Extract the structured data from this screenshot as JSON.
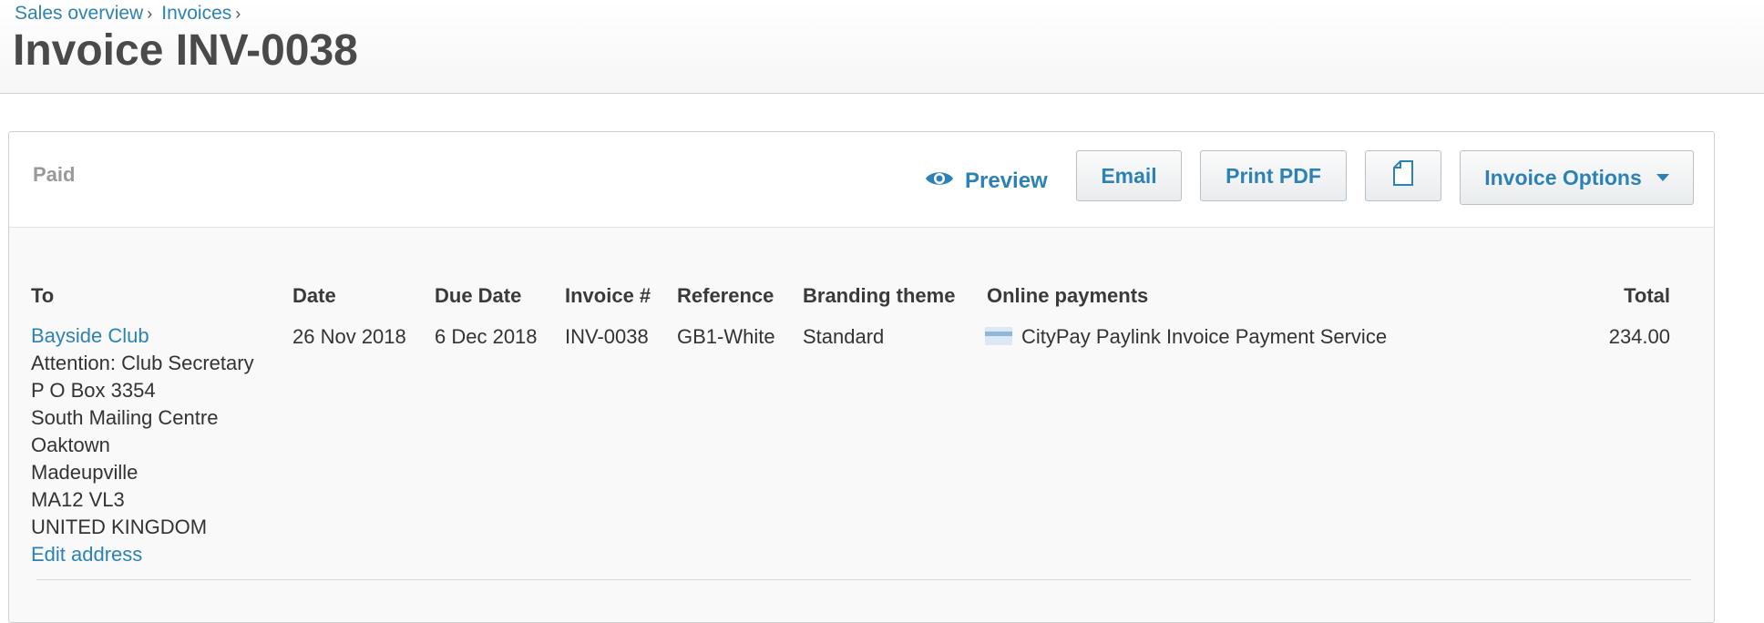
{
  "breadcrumb": [
    {
      "label": "Sales overview"
    },
    {
      "label": "Invoices"
    }
  ],
  "breadcrumb_separator": "›",
  "page_title": "Invoice INV-0038",
  "toolbar": {
    "status": "Paid",
    "preview_label": "Preview",
    "email_label": "Email",
    "print_pdf_label": "Print PDF",
    "invoice_options_label": "Invoice Options"
  },
  "columns": {
    "to": "To",
    "date": "Date",
    "due_date": "Due Date",
    "invoice_number": "Invoice #",
    "reference": "Reference",
    "branding_theme": "Branding theme",
    "online_payments": "Online payments",
    "total": "Total"
  },
  "invoice": {
    "contact_name": "Bayside Club",
    "address_lines": [
      "Attention: Club Secretary",
      "P O Box 3354",
      "South Mailing Centre",
      "Oaktown",
      "Madeupville",
      "MA12 VL3",
      "UNITED KINGDOM"
    ],
    "edit_address_label": "Edit address",
    "date": "26 Nov 2018",
    "due_date": "6 Dec 2018",
    "invoice_number": "INV-0038",
    "reference": "GB1-White",
    "branding_theme": "Standard",
    "online_payment_service": "CityPay Paylink Invoice Payment Service",
    "total": "234.00"
  },
  "icons": {
    "preview": "eye-icon",
    "copy": "document-icon",
    "dropdown": "caret-down-icon",
    "card": "credit-card-icon"
  },
  "colors": {
    "link": "#2d82b5",
    "status": "#999999",
    "title": "#4a4a4a"
  }
}
